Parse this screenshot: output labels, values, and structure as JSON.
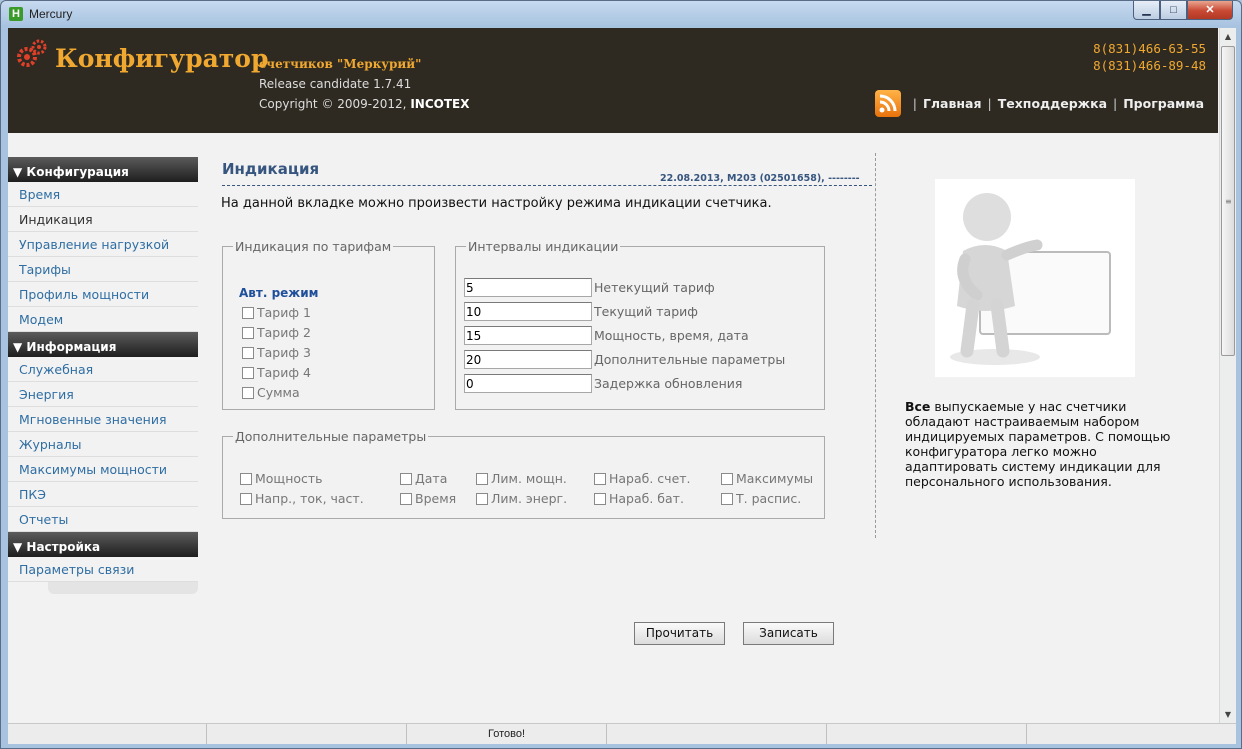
{
  "window": {
    "title": "Mercury",
    "icon_letter": "H",
    "min_glyph": "▁",
    "max_glyph": "□",
    "close_glyph": "✕"
  },
  "header": {
    "logo": "Конфигуратор",
    "subtitle": "счетчиков \"Меркурий\"",
    "release": "Release candidate 1.7.41",
    "copyright_prefix": "Copyright © 2009-2012, ",
    "copyright_company": "INCOTEX",
    "phones": [
      "8(831)466-63-55",
      "8(831)466-89-48"
    ],
    "nav": [
      "Главная",
      "Техподдержка",
      "Программа"
    ],
    "separator": "|",
    "accent_color": "#f0a830"
  },
  "sidebar": {
    "sections": [
      {
        "title": "▼ Конфигурация",
        "items": [
          "Время",
          "Индикация",
          "Управление нагрузкой",
          "Тарифы",
          "Профиль мощности",
          "Модем"
        ]
      },
      {
        "title": "▼ Информация",
        "items": [
          "Служебная",
          "Энергия",
          "Мгновенные значения",
          "Журналы",
          "Максимумы мощности",
          "ПКЭ",
          "Отчеты"
        ]
      },
      {
        "title": "▼ Настройка",
        "items": [
          "Параметры связи"
        ]
      }
    ],
    "active_item": "Индикация"
  },
  "main": {
    "title": "Индикация",
    "date_info": "22.08.2013, M203 (02501658), --------",
    "description": "На данной вкладке можно произвести настройку режима индикации счетчика.",
    "tariff_group": {
      "legend": "Индикация по тарифам",
      "auto_mode": "Авт. режим",
      "options": [
        "Тариф 1",
        "Тариф 2",
        "Тариф 3",
        "Тариф 4",
        "Сумма"
      ]
    },
    "interval_group": {
      "legend": "Интервалы индикации",
      "fields": [
        {
          "value": "5",
          "label": "Нетекущий тариф"
        },
        {
          "value": "10",
          "label": "Текущий тариф"
        },
        {
          "value": "15",
          "label": "Мощность, время, дата"
        },
        {
          "value": "20",
          "label": "Дополнительные параметры"
        },
        {
          "value": "0",
          "label": "Задержка обновления"
        }
      ]
    },
    "extra_group": {
      "legend": "Дополнительные параметры",
      "row1": [
        "Мощность",
        "Дата",
        "Лим. мощн.",
        "Нараб. счет.",
        "Максимумы"
      ],
      "row2": [
        "Напр., ток, част.",
        "Время",
        "Лим. энерг.",
        "Нараб. бат.",
        "Т. распис."
      ]
    },
    "buttons": {
      "read": "Прочитать",
      "write": "Записать"
    }
  },
  "aside": {
    "bold_word": "Все",
    "text": " выпускаемые у нас счетчики обладают настраиваемым набором индицируемых параметров. С помощью конфигуратора легко можно адаптировать систему индикации для персонального использования."
  },
  "status": {
    "text": "Готово!"
  },
  "scrollbar": {
    "up": "▲",
    "down": "▼",
    "grip": "≡"
  }
}
